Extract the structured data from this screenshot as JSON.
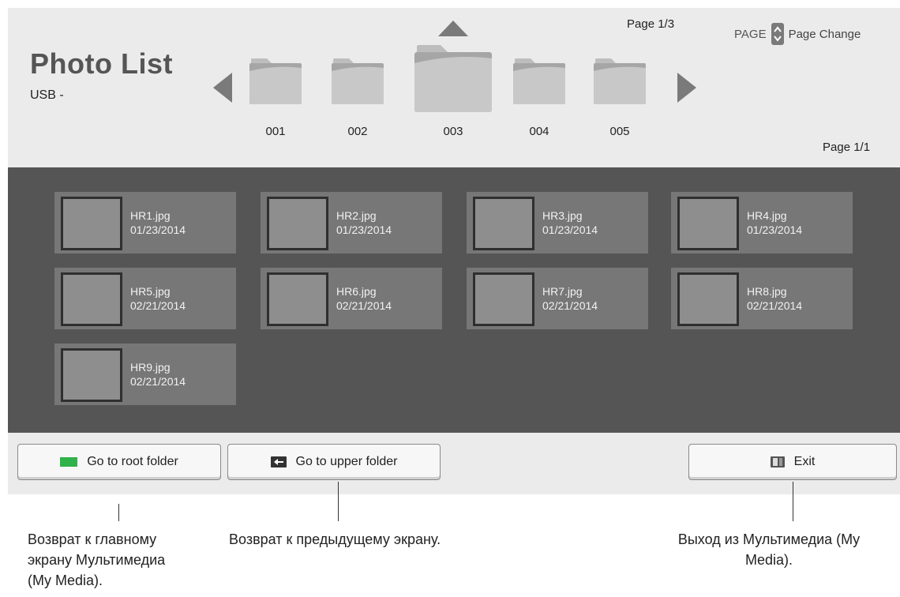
{
  "header": {
    "title": "Photo List",
    "source": "USB -",
    "page_top": "Page 1/3",
    "page_bottom": "Page 1/1",
    "page_key": "PAGE",
    "page_change": "Page Change"
  },
  "folders": [
    {
      "label": "001",
      "selected": false
    },
    {
      "label": "002",
      "selected": false
    },
    {
      "label": "003",
      "selected": true
    },
    {
      "label": "004",
      "selected": false
    },
    {
      "label": "005",
      "selected": false
    }
  ],
  "photos": [
    {
      "name": "HR1.jpg",
      "date": "01/23/2014"
    },
    {
      "name": "HR2.jpg",
      "date": "01/23/2014"
    },
    {
      "name": "HR3.jpg",
      "date": "01/23/2014"
    },
    {
      "name": "HR4.jpg",
      "date": "01/23/2014"
    },
    {
      "name": "HR5.jpg",
      "date": "02/21/2014"
    },
    {
      "name": "HR6.jpg",
      "date": "02/21/2014"
    },
    {
      "name": "HR7.jpg",
      "date": "02/21/2014"
    },
    {
      "name": "HR8.jpg",
      "date": "02/21/2014"
    },
    {
      "name": "HR9.jpg",
      "date": "02/21/2014"
    }
  ],
  "buttons": {
    "root_label": "Go to root folder",
    "upper_label": "Go to upper folder",
    "exit_label": "Exit"
  },
  "annotations": {
    "root": [
      "Возврат к главному",
      "экрану Мультимедиа",
      "(My Media)."
    ],
    "upper": [
      "Возврат к предыдущему экрану."
    ],
    "exit": [
      "Выход из Мультимедиа (My",
      "Media)."
    ]
  },
  "colors": {
    "header_bg": "#ebebeb",
    "grid_bg": "#555555",
    "tile_bg": "#777777",
    "green_key": "#2fb24a"
  }
}
